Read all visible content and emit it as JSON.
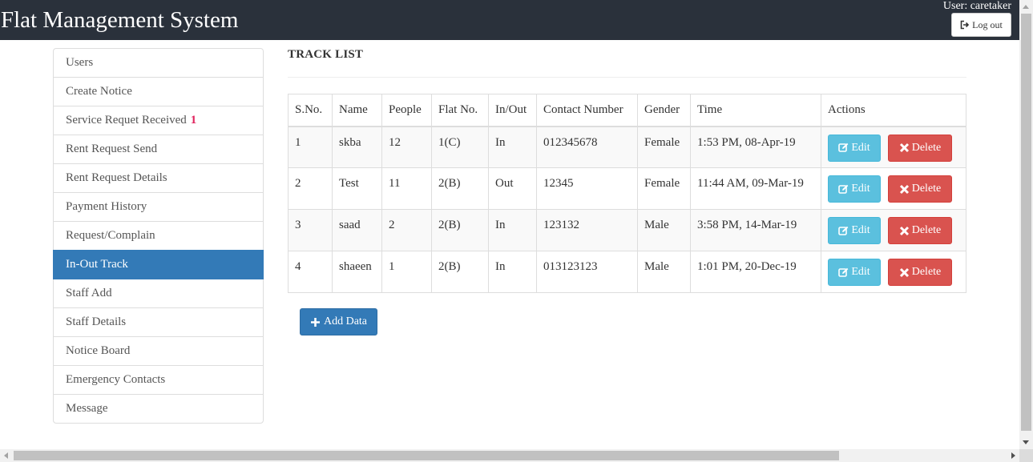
{
  "header": {
    "brand": "Flat Management System",
    "user_label": "User: caretaker",
    "logout_label": "Log out"
  },
  "sidebar": {
    "items": [
      {
        "label": "Users"
      },
      {
        "label": "Create Notice"
      },
      {
        "label": "Service Requet Received",
        "badge": "1"
      },
      {
        "label": "Rent Request Send"
      },
      {
        "label": "Rent Request Details"
      },
      {
        "label": "Payment History"
      },
      {
        "label": "Request/Complain"
      },
      {
        "label": "In-Out Track",
        "active": true
      },
      {
        "label": "Staff Add"
      },
      {
        "label": "Staff Details"
      },
      {
        "label": "Notice Board"
      },
      {
        "label": "Emergency Contacts"
      },
      {
        "label": "Message"
      }
    ]
  },
  "main": {
    "title": "TRACK LIST",
    "table": {
      "columns": [
        "S.No.",
        "Name",
        "People",
        "Flat No.",
        "In/Out",
        "Contact Number",
        "Gender",
        "Time",
        "Actions"
      ],
      "rows": [
        [
          "1",
          "skba",
          "12",
          "1(C)",
          "In",
          "012345678",
          "Female",
          "1:53 PM, 08-Apr-19"
        ],
        [
          "2",
          "Test",
          "11",
          "2(B)",
          "Out",
          "12345",
          "Female",
          "11:44 AM, 09-Mar-19"
        ],
        [
          "3",
          "saad",
          "2",
          "2(B)",
          "In",
          "123132",
          "Male",
          "3:58 PM, 14-Mar-19"
        ],
        [
          "4",
          "shaeen",
          "1",
          "2(B)",
          "In",
          "013123123",
          "Male",
          "1:01 PM, 20-Dec-19"
        ]
      ],
      "edit_label": "Edit",
      "delete_label": "Delete"
    },
    "add_label": "Add Data"
  },
  "colors": {
    "topbar": "#2a313b",
    "primary": "#337ab7",
    "info": "#5bc0de",
    "danger": "#d9534f",
    "badge": "#e0245e"
  }
}
